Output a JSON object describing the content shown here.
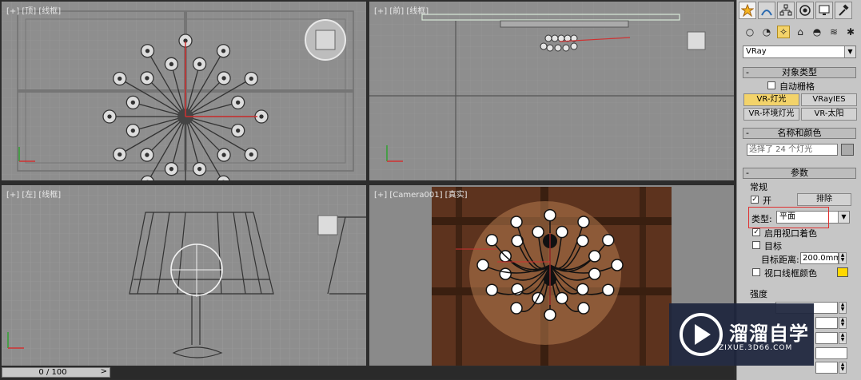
{
  "viewports": {
    "top": {
      "label": "[+] [顶] [线框]"
    },
    "front": {
      "label": "[+] [前] [线框]"
    },
    "left": {
      "label": "[+] [左] [线框]"
    },
    "camera": {
      "label": "[+] [Camera001] [真实]"
    }
  },
  "timeline": {
    "frame": "0 / 100",
    "next": ">"
  },
  "panel": {
    "tabs": [
      "create-tab",
      "modify-tab",
      "hierarchy-tab",
      "motion-tab",
      "display-tab",
      "utilities-tab"
    ],
    "category_icons": [
      "geometry-icon",
      "shapes-icon",
      "lights-icon",
      "cameras-icon",
      "helpers-icon",
      "spacewarps-icon",
      "systems-icon"
    ],
    "renderer": "VRay",
    "object_type": {
      "title": "对象类型",
      "autogrid": "自动栅格",
      "buttons": [
        "VR-灯光",
        "VRayIES",
        "VR-环境灯光",
        "VR-太阳"
      ]
    },
    "name_color": {
      "title": "名称和颜色",
      "name_value": "选择了 24 个灯光"
    },
    "params": {
      "title": "参数",
      "general": "常规",
      "on_label": "开",
      "exclude": "排除",
      "type_label": "类型:",
      "type_value": "平面",
      "viewport_shading": "启用视口着色",
      "target": "目标",
      "target_distance_label": "目标距离:",
      "target_distance": "200.0mm",
      "viewport_wire_color": "视口线框颜色",
      "intensity": "强度"
    }
  },
  "watermark": {
    "title": "溜溜自学",
    "url": "ZIXUE.3D66.COM"
  },
  "colors": {
    "accent": "#f3d36a",
    "highlight": "#e03030",
    "active_viewport": "#e8c030",
    "swatch": "#ffd800"
  }
}
